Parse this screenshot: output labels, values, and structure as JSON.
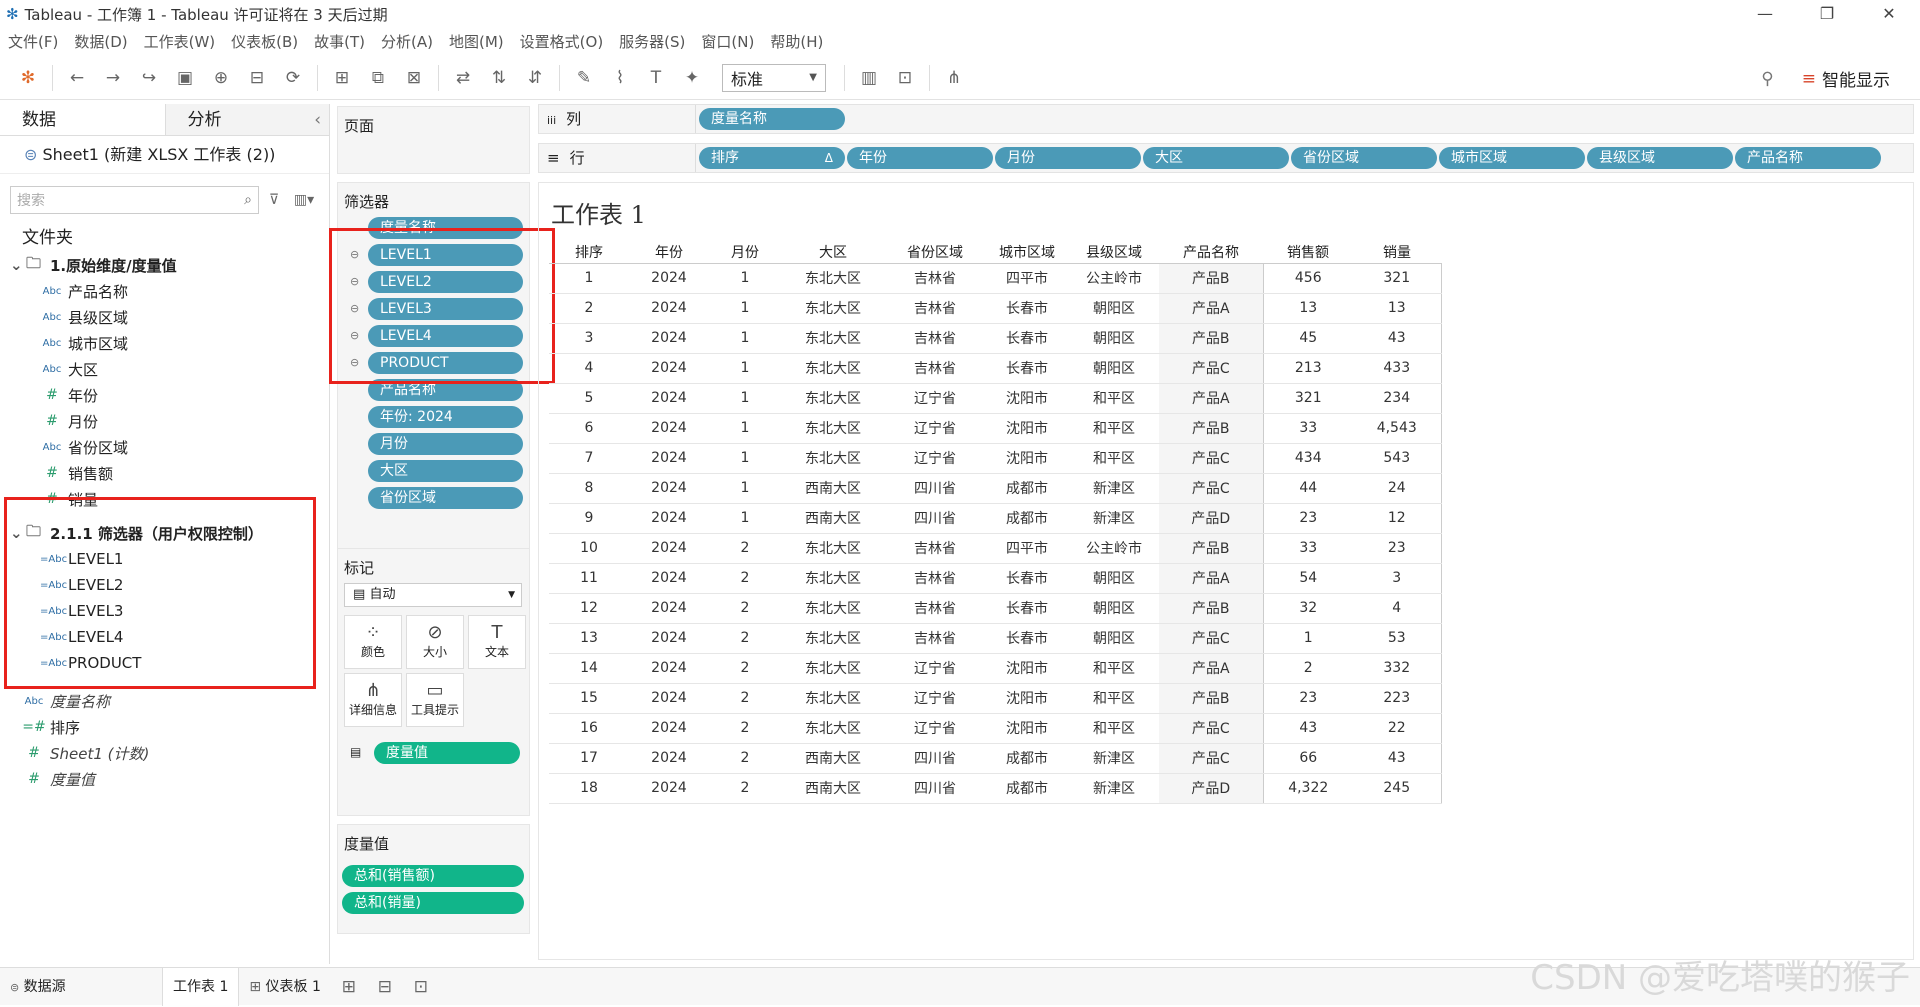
{
  "window": {
    "title": "Tableau - 工作簿 1 - Tableau 许可证将在 3 天后过期"
  },
  "menu": [
    "文件(F)",
    "数据(D)",
    "工作表(W)",
    "仪表板(B)",
    "故事(T)",
    "分析(A)",
    "地图(M)",
    "设置格式(O)",
    "服务器(S)",
    "窗口(N)",
    "帮助(H)"
  ],
  "toolbar": {
    "fit_select": "标准",
    "smart_show": "智能显示"
  },
  "left": {
    "tab_data": "数据",
    "tab_analysis": "分析",
    "source": "Sheet1 (新建 XLSX 工作表 (2))",
    "search_placeholder": "搜索",
    "folders_label": "文件夹",
    "group1": {
      "name": "1.原始维度/度量值",
      "items": [
        {
          "type": "Abc",
          "label": "产品名称"
        },
        {
          "type": "Abc",
          "label": "县级区域"
        },
        {
          "type": "Abc",
          "label": "城市区域"
        },
        {
          "type": "Abc",
          "label": "大区"
        },
        {
          "type": "#",
          "label": "年份"
        },
        {
          "type": "#",
          "label": "月份"
        },
        {
          "type": "Abc",
          "label": "省份区域"
        },
        {
          "type": "#",
          "label": "销售额"
        },
        {
          "type": "#",
          "label": "销量"
        }
      ]
    },
    "group2": {
      "name": "2.1.1 筛选器（用户权限控制）",
      "items": [
        {
          "type": "=Abc",
          "label": "LEVEL1"
        },
        {
          "type": "=Abc",
          "label": "LEVEL2"
        },
        {
          "type": "=Abc",
          "label": "LEVEL3"
        },
        {
          "type": "=Abc",
          "label": "LEVEL4"
        },
        {
          "type": "=Abc",
          "label": "PRODUCT"
        }
      ]
    },
    "extra": [
      {
        "type": "Abc",
        "label": "度量名称"
      },
      {
        "type": "=#",
        "label": "排序"
      },
      {
        "type": "#",
        "label": "Sheet1 (计数)"
      },
      {
        "type": "#",
        "label": "度量值"
      }
    ]
  },
  "cards": {
    "pages": "页面",
    "filters": "筛选器",
    "filter_pills": [
      "度量名称",
      "LEVEL1",
      "LEVEL2",
      "LEVEL3",
      "LEVEL4",
      "PRODUCT",
      "产品名称",
      "年份: 2024",
      "月份",
      "大区",
      "省份区域"
    ],
    "marks": "标记",
    "marks_type": "自动",
    "mark_buttons": [
      "颜色",
      "大小",
      "文本",
      "详细信息",
      "工具提示"
    ],
    "marks_pill": "度量值",
    "measure_values": "度量值",
    "measure_pills": [
      "总和(销售额)",
      "总和(销量)"
    ]
  },
  "shelves": {
    "columns_label": "列",
    "columns_pills": [
      "度量名称"
    ],
    "rows_label": "行",
    "rows_pills": [
      "排序",
      "年份",
      "月份",
      "大区",
      "省份区域",
      "城市区域",
      "县级区域",
      "产品名称"
    ],
    "sort_mark": "Δ"
  },
  "sheet": {
    "title": "工作表 1",
    "headers": [
      "排序",
      "年份",
      "月份",
      "大区",
      "省份区域",
      "城市区域",
      "县级区域",
      "产品名称",
      "销售额",
      "销量"
    ],
    "rows": [
      [
        "1",
        "2024",
        "1",
        "东北大区",
        "吉林省",
        "四平市",
        "公主岭市",
        "产品B",
        "456",
        "321"
      ],
      [
        "2",
        "2024",
        "1",
        "东北大区",
        "吉林省",
        "长春市",
        "朝阳区",
        "产品A",
        "13",
        "13"
      ],
      [
        "3",
        "2024",
        "1",
        "东北大区",
        "吉林省",
        "长春市",
        "朝阳区",
        "产品B",
        "45",
        "43"
      ],
      [
        "4",
        "2024",
        "1",
        "东北大区",
        "吉林省",
        "长春市",
        "朝阳区",
        "产品C",
        "213",
        "433"
      ],
      [
        "5",
        "2024",
        "1",
        "东北大区",
        "辽宁省",
        "沈阳市",
        "和平区",
        "产品A",
        "321",
        "234"
      ],
      [
        "6",
        "2024",
        "1",
        "东北大区",
        "辽宁省",
        "沈阳市",
        "和平区",
        "产品B",
        "33",
        "4,543"
      ],
      [
        "7",
        "2024",
        "1",
        "东北大区",
        "辽宁省",
        "沈阳市",
        "和平区",
        "产品C",
        "434",
        "543"
      ],
      [
        "8",
        "2024",
        "1",
        "西南大区",
        "四川省",
        "成都市",
        "新津区",
        "产品C",
        "44",
        "24"
      ],
      [
        "9",
        "2024",
        "1",
        "西南大区",
        "四川省",
        "成都市",
        "新津区",
        "产品D",
        "23",
        "12"
      ],
      [
        "10",
        "2024",
        "2",
        "东北大区",
        "吉林省",
        "四平市",
        "公主岭市",
        "产品B",
        "33",
        "23"
      ],
      [
        "11",
        "2024",
        "2",
        "东北大区",
        "吉林省",
        "长春市",
        "朝阳区",
        "产品A",
        "54",
        "3"
      ],
      [
        "12",
        "2024",
        "2",
        "东北大区",
        "吉林省",
        "长春市",
        "朝阳区",
        "产品B",
        "32",
        "4"
      ],
      [
        "13",
        "2024",
        "2",
        "东北大区",
        "吉林省",
        "长春市",
        "朝阳区",
        "产品C",
        "1",
        "53"
      ],
      [
        "14",
        "2024",
        "2",
        "东北大区",
        "辽宁省",
        "沈阳市",
        "和平区",
        "产品A",
        "2",
        "332"
      ],
      [
        "15",
        "2024",
        "2",
        "东北大区",
        "辽宁省",
        "沈阳市",
        "和平区",
        "产品B",
        "23",
        "223"
      ],
      [
        "16",
        "2024",
        "2",
        "东北大区",
        "辽宁省",
        "沈阳市",
        "和平区",
        "产品C",
        "43",
        "22"
      ],
      [
        "17",
        "2024",
        "2",
        "西南大区",
        "四川省",
        "成都市",
        "新津区",
        "产品C",
        "66",
        "43"
      ],
      [
        "18",
        "2024",
        "2",
        "西南大区",
        "四川省",
        "成都市",
        "新津区",
        "产品D",
        "4,322",
        "245"
      ]
    ]
  },
  "bottom": {
    "datasource": "数据源",
    "sheet_tab": "工作表 1",
    "dashboard_tab": "仪表板 1"
  },
  "watermark": "CSDN @爱吃塔噗的猴子",
  "colors": {
    "pill_blue": "#4b9ab7",
    "pill_green": "#11b58a",
    "highlight_red": "#e8221c"
  }
}
